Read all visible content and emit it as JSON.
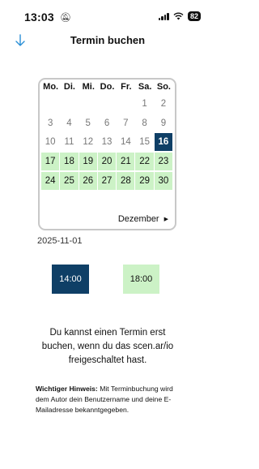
{
  "status_bar": {
    "time": "13:03",
    "battery": "82"
  },
  "header": {
    "title": "Termin buchen"
  },
  "calendar": {
    "weekdays": [
      "Mo.",
      "Di.",
      "Mi.",
      "Do.",
      "Fr.",
      "Sa.",
      "So."
    ],
    "days": [
      {
        "label": "",
        "state": "empty"
      },
      {
        "label": "",
        "state": "empty"
      },
      {
        "label": "",
        "state": "empty"
      },
      {
        "label": "",
        "state": "empty"
      },
      {
        "label": "",
        "state": "empty"
      },
      {
        "label": "1",
        "state": "past"
      },
      {
        "label": "2",
        "state": "past"
      },
      {
        "label": "3",
        "state": "past"
      },
      {
        "label": "4",
        "state": "past"
      },
      {
        "label": "5",
        "state": "past"
      },
      {
        "label": "6",
        "state": "past"
      },
      {
        "label": "7",
        "state": "past"
      },
      {
        "label": "8",
        "state": "past"
      },
      {
        "label": "9",
        "state": "past"
      },
      {
        "label": "10",
        "state": "past"
      },
      {
        "label": "11",
        "state": "past"
      },
      {
        "label": "12",
        "state": "past"
      },
      {
        "label": "13",
        "state": "past"
      },
      {
        "label": "14",
        "state": "past"
      },
      {
        "label": "15",
        "state": "past"
      },
      {
        "label": "16",
        "state": "selected"
      },
      {
        "label": "17",
        "state": "available"
      },
      {
        "label": "18",
        "state": "available"
      },
      {
        "label": "19",
        "state": "available"
      },
      {
        "label": "20",
        "state": "available"
      },
      {
        "label": "21",
        "state": "available"
      },
      {
        "label": "22",
        "state": "available"
      },
      {
        "label": "23",
        "state": "available"
      },
      {
        "label": "24",
        "state": "available"
      },
      {
        "label": "25",
        "state": "available"
      },
      {
        "label": "26",
        "state": "available"
      },
      {
        "label": "27",
        "state": "available"
      },
      {
        "label": "28",
        "state": "available"
      },
      {
        "label": "29",
        "state": "available"
      },
      {
        "label": "30",
        "state": "available"
      }
    ],
    "next_month_label": "Dezember"
  },
  "selected_date": "2025-11-01",
  "time_slots": [
    {
      "label": "14:00",
      "selected": true
    },
    {
      "label": "18:00",
      "selected": false
    }
  ],
  "info_text": "Du kannst einen Termin erst buchen, wenn du das scen.ar/io freigeschaltet hast.",
  "hint": {
    "label": "Wichtiger Hinweis:",
    "text": " Mit Terminbuchung wird dem Autor dein Benutzername und deine E-Mailadresse bekanntgegeben."
  },
  "colors": {
    "selected": "#0f3f66",
    "available": "#ccf2c6"
  }
}
